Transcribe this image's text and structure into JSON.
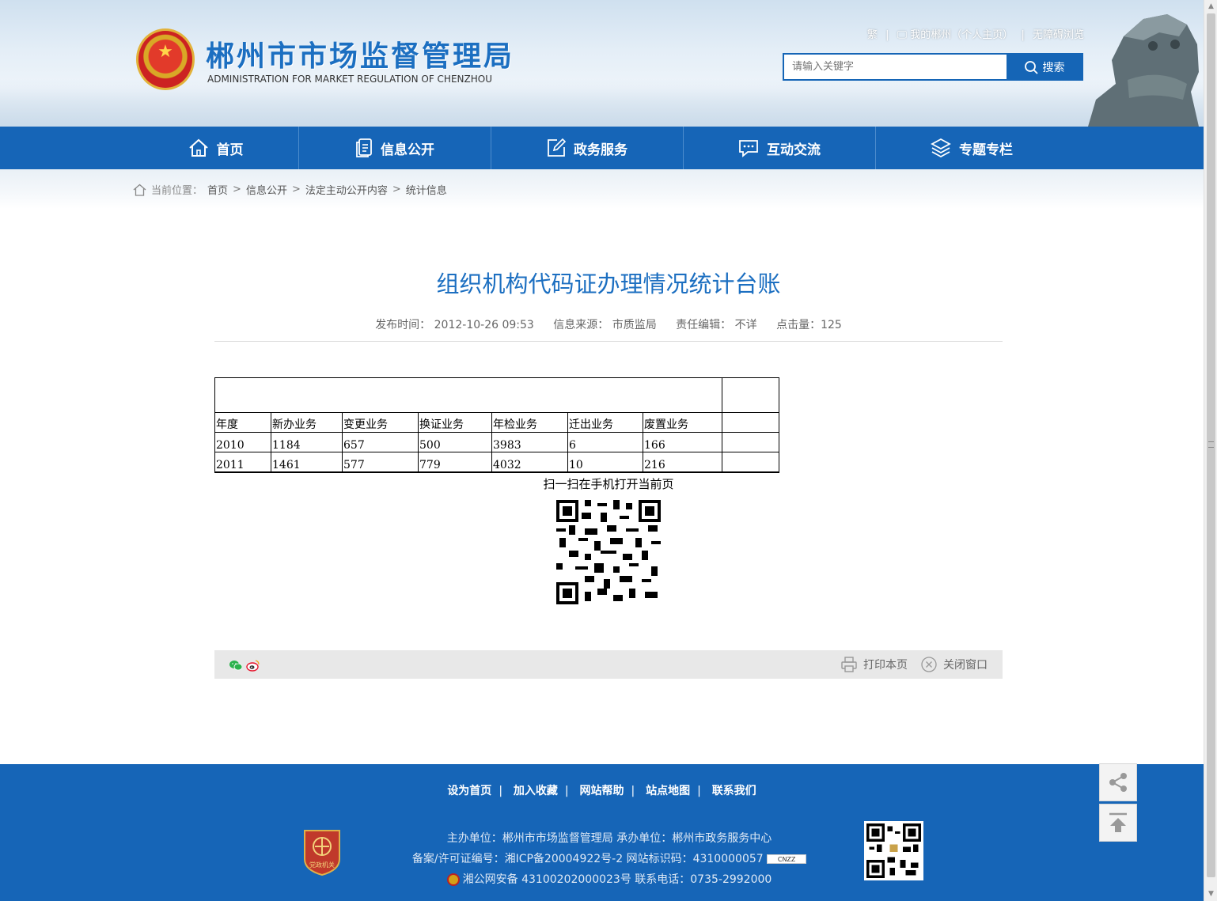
{
  "header": {
    "site_title": "郴州市市场监督管理局",
    "site_subtitle": "ADMINISTRATION FOR MARKET REGULATION OF CHENZHOU",
    "toplinks": {
      "traditional": "繁",
      "my_chenzhou": "我的郴州（个人主页）",
      "accessible": "无障碍浏览"
    },
    "search": {
      "placeholder": "请输入关键字",
      "button": "搜索"
    }
  },
  "nav": [
    {
      "label": "首页",
      "icon": "home-icon"
    },
    {
      "label": "信息公开",
      "icon": "document-icon"
    },
    {
      "label": "政务服务",
      "icon": "edit-icon"
    },
    {
      "label": "互动交流",
      "icon": "chat-icon"
    },
    {
      "label": "专题专栏",
      "icon": "layers-icon"
    }
  ],
  "breadcrumb": {
    "prefix": "当前位置：",
    "items": [
      "首页",
      "信息公开",
      "法定主动公开内容",
      "统计信息"
    ]
  },
  "article": {
    "title": "组织机构代码证办理情况统计台账",
    "meta": {
      "time_label": "发布时间：",
      "time": "2012-10-26 09:53",
      "source_label": "信息来源：",
      "source": "市质监局",
      "editor_label": "责任编辑：",
      "editor": "不详",
      "hits_label": "点击量：",
      "hits": "125"
    },
    "table": {
      "headers": [
        "年度",
        "新办业务",
        "变更业务",
        "换证业务",
        "年检业务",
        "迁出业务",
        "废置业务",
        ""
      ],
      "rows": [
        [
          "2010",
          "1184",
          "657",
          "500",
          "3983",
          "6",
          "166",
          ""
        ],
        [
          "2011",
          "1461",
          "577",
          "779",
          "4032",
          "10",
          "216",
          ""
        ]
      ]
    },
    "scan_text": "扫一扫在手机打开当前页",
    "actions": {
      "print": "打印本页",
      "close": "关闭窗口"
    }
  },
  "footer": {
    "links": [
      "设为首页",
      "加入收藏",
      "网站帮助",
      "站点地图",
      "联系我们"
    ],
    "line1": "主办单位：郴州市市场监督管理局   承办单位：郴州市政务服务中心",
    "line2": "备案/许可证编号：湘ICP备20004922号-2    网站标识码：4310000057",
    "line3": "湘公网安备 43100202000023号  联系电话：0735-2992000",
    "badge_text": "党政机关",
    "cnzz_text": "CNZZ"
  },
  "colors": {
    "brand_blue": "#1665b7",
    "title_blue": "#1c6fc1",
    "share_bar": "#e8e8e8"
  }
}
